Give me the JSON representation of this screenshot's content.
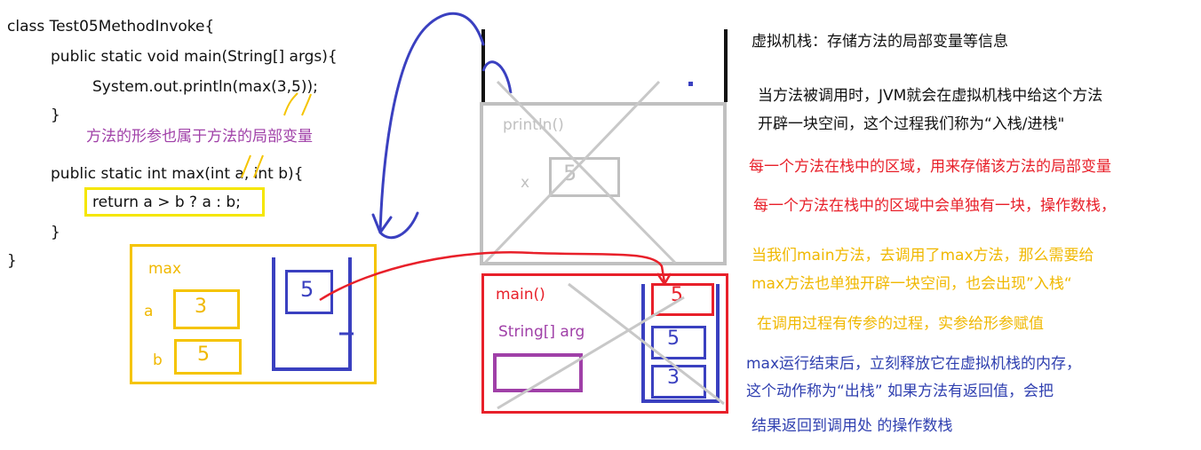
{
  "code": {
    "line1": "class Test05MethodInvoke{",
    "line2": "public static void main(String[] args){",
    "line3": "System.out.println(max(3,5));",
    "line4": "}",
    "line5": "public static int max(int a, int b){",
    "line6": "return a > b ? a : b;",
    "line7": "}",
    "line8": "}",
    "comment": "方法的形参也属于方法的局部变量"
  },
  "max_frame": {
    "title": "max",
    "var_a": "a",
    "var_b": "b",
    "val_a": "3",
    "val_b": "5",
    "stack_val": "5"
  },
  "println_frame": {
    "title": "println()",
    "var_x": "x",
    "val_x": "5"
  },
  "main_frame": {
    "title": "main()",
    "var_args": "String[] arg",
    "stack_top": "5",
    "stack_mid": "5",
    "stack_bottom": "3"
  },
  "notes": {
    "n1": "虚拟机栈：存储方法的局部变量等信息",
    "n2a": "当方法被调用时，JVM就会在虚拟机栈中给这个方法",
    "n2b": "开辟一块空间，这个过程我们称为“入栈/进栈\"",
    "n3": "每一个方法在栈中的区域，用来存储该方法的局部变量",
    "n4": "每一个方法在栈中的区域中会单独有一块，操作数栈，",
    "n5a": "当我们main方法，去调用了max方法，那么需要给",
    "n5b": "max方法也单独开辟一块空间，也会出现”入栈“",
    "n6": "在调用过程有传参的过程，实参给形参赋值",
    "n7a": "max运行结束后，立刻释放它在虚拟机栈的内存，",
    "n7b": "这个动作称为“出栈” 如果方法有返回值，会把",
    "n7c": "结果返回到调用处 的操作数栈"
  },
  "colors": {
    "code": "#111111",
    "purple": "#a040a8",
    "yellow": "#f5c400",
    "blue": "#3a40c0",
    "red": "#e8202a",
    "gray": "#c0c0c0",
    "orange_text": "#f0b800",
    "blue_text": "#3040b0"
  }
}
